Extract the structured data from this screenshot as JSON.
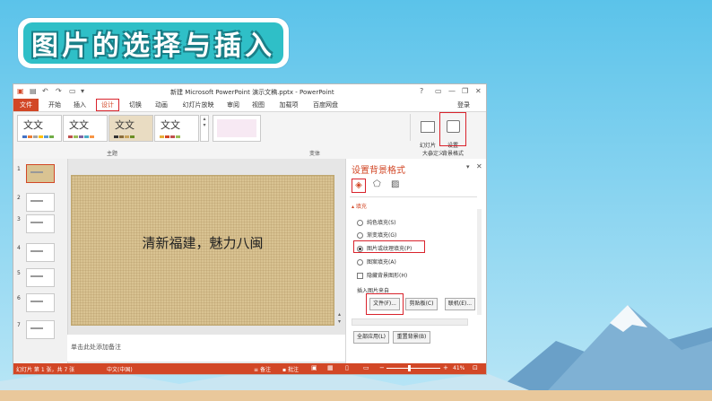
{
  "banner": {
    "title": "图片的选择与插入"
  },
  "window": {
    "title": "新建 Microsoft PowerPoint 演示文稿.pptx - PowerPoint",
    "controls": [
      "?",
      "▭",
      "—",
      "❐",
      "✕"
    ],
    "login": "登录"
  },
  "ribbon_tabs": [
    "文件",
    "开始",
    "插入",
    "设计",
    "切换",
    "动画",
    "幻灯片放映",
    "审阅",
    "视图",
    "加载项",
    "百度网盘"
  ],
  "themes": {
    "items": [
      "文文",
      "文文",
      "文文",
      "文文"
    ],
    "group_label": "主题"
  },
  "variants": {
    "group_label": "变体"
  },
  "customize": {
    "slide_size": "幻灯片\n大小",
    "format_bg": "设置\n背景格式",
    "group_label": "自定义"
  },
  "thumbnails": [
    "1",
    "2",
    "3",
    "4",
    "5",
    "6",
    "7"
  ],
  "slide": {
    "text": "清新福建，魅力八闽"
  },
  "notes": {
    "placeholder": "单击此处添加备注"
  },
  "pane": {
    "title": "设置背景格式",
    "section": "填充",
    "options": [
      "纯色填充(S)",
      "渐变填充(G)",
      "图片或纹理填充(P)",
      "图案填充(A)",
      "隐藏背景图形(H)"
    ],
    "selected_option": 2,
    "insert_from": "插入图片来自",
    "buttons": {
      "file": "文件(F)...",
      "clipboard": "剪贴板(C)",
      "online": "联机(E)..."
    },
    "apply_all": "全部应用(L)",
    "reset": "重置背景(B)"
  },
  "statusbar": {
    "left": "幻灯片 第 1 张，共 7 张",
    "lang": "中文(中国)",
    "notes": "备注",
    "comments": "批注",
    "zoom": "41%"
  },
  "colors": {
    "ppt_orange": "#d24726",
    "highlight": "#d9232c",
    "banner": "#2fbfc7"
  }
}
